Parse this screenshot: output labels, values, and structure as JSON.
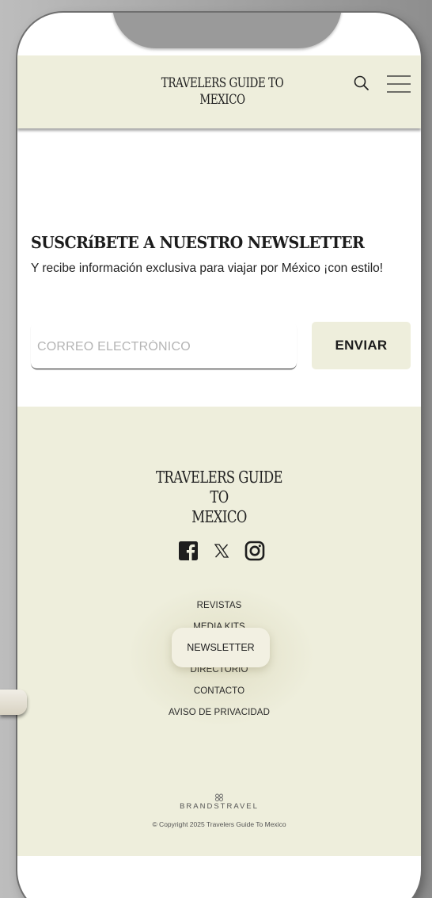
{
  "header": {
    "brand_line1": "TRAVELERS GUIDE TO",
    "brand_line2": "MEXICO",
    "search_icon": "search-icon",
    "menu_icon": "hamburger-menu-icon"
  },
  "newsletter": {
    "title": "SUSCRíBETE A NUESTRO NEWSLETTER",
    "subtitle": "Y recibe información exclusiva para viajar por México ¡con estilo!",
    "email_placeholder": "CORREO ELECTRÓNICO",
    "send_label": "ENVIAR"
  },
  "footer": {
    "brand_line1": "TRAVELERS GUIDE TO",
    "brand_line2": "MEXICO",
    "social": [
      "facebook-icon",
      "x-icon",
      "instagram-icon"
    ],
    "nav": [
      "REVISTAS",
      "MEDIA KITS",
      "NEWSLETTER",
      "DIRECTORIO",
      "CONTACTO",
      "AVISO DE PRIVACIDAD"
    ],
    "highlighted_nav": "NEWSLETTER",
    "logo_text": "BRANDSTRAVEL",
    "copyright": "© Copyright 2025 Travelers Guide To Mexico"
  },
  "colors": {
    "accent_bg": "#eeeedc",
    "text": "#222222"
  }
}
